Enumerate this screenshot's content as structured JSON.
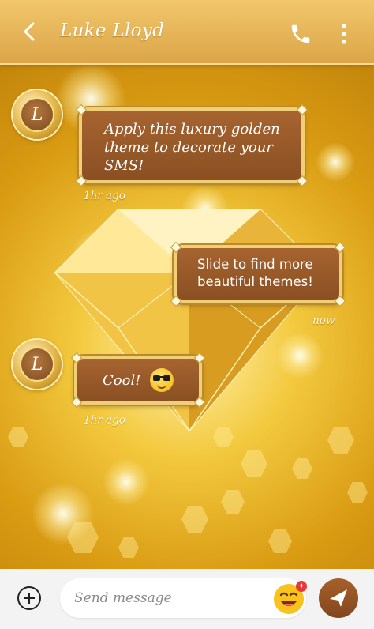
{
  "header": {
    "contact_name": "Luke Lloyd",
    "back_icon": "back-arrow-icon",
    "call_icon": "phone-icon",
    "more_icon": "more-vertical-icon"
  },
  "theme": {
    "accent_brown": "#8a4f22",
    "accent_gold": "#f1cf78",
    "background_gold": "#d8a018"
  },
  "messages": [
    {
      "direction": "incoming",
      "avatar_letter": "L",
      "text": "Apply this luxury golden theme to decorate your SMS!",
      "time": "1hr ago"
    },
    {
      "direction": "outgoing",
      "text": "Slide to find more beautiful themes!",
      "time": "now"
    },
    {
      "direction": "incoming",
      "avatar_letter": "L",
      "text": "Cool!",
      "emoji": "sunglasses-emoji-icon",
      "time": "1hr ago"
    }
  ],
  "composer": {
    "placeholder": "Send message",
    "add_icon": "plus-circle-icon",
    "emoji_icon": "emoji-icon",
    "send_icon": "send-icon"
  }
}
